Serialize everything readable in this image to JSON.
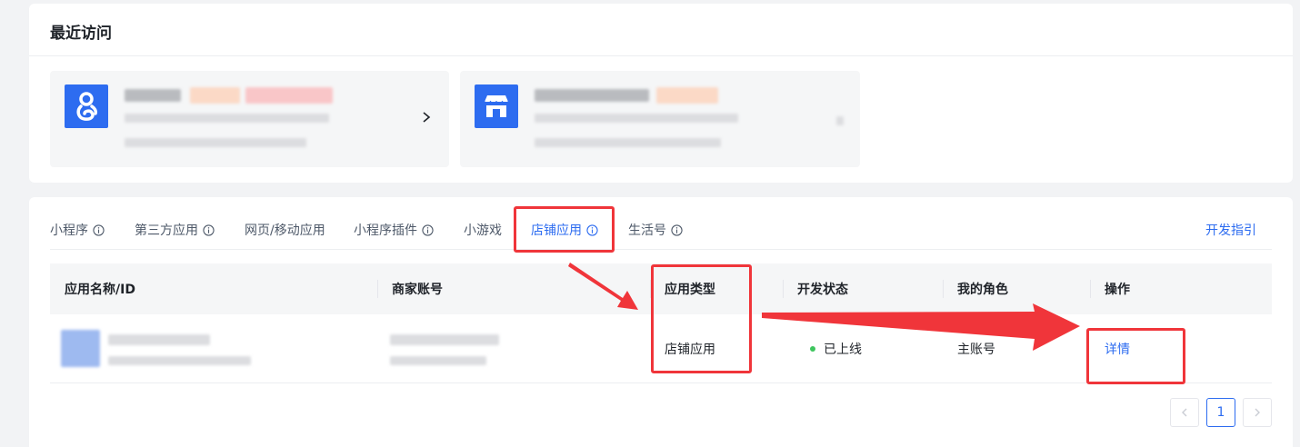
{
  "recent": {
    "title": "最近访问"
  },
  "tabs": [
    {
      "label": "小程序",
      "has_info": true
    },
    {
      "label": "第三方应用",
      "has_info": true
    },
    {
      "label": "网页/移动应用",
      "has_info": false
    },
    {
      "label": "小程序插件",
      "has_info": true
    },
    {
      "label": "小游戏",
      "has_info": false
    },
    {
      "label": "店铺应用",
      "has_info": true,
      "active": true
    },
    {
      "label": "生活号",
      "has_info": true
    }
  ],
  "dev_guide": "开发指引",
  "table": {
    "columns": [
      "应用名称/ID",
      "商家账号",
      "应用类型",
      "开发状态",
      "我的角色",
      "操作"
    ],
    "rows": [
      {
        "app_type": "店铺应用",
        "status": "已上线",
        "role": "主账号",
        "action": "详情"
      }
    ]
  },
  "pagination": {
    "current_page": "1"
  },
  "colors": {
    "accent": "#2d6cf0",
    "highlight_red": "#f0353a",
    "status_online": "#3ec55e"
  }
}
